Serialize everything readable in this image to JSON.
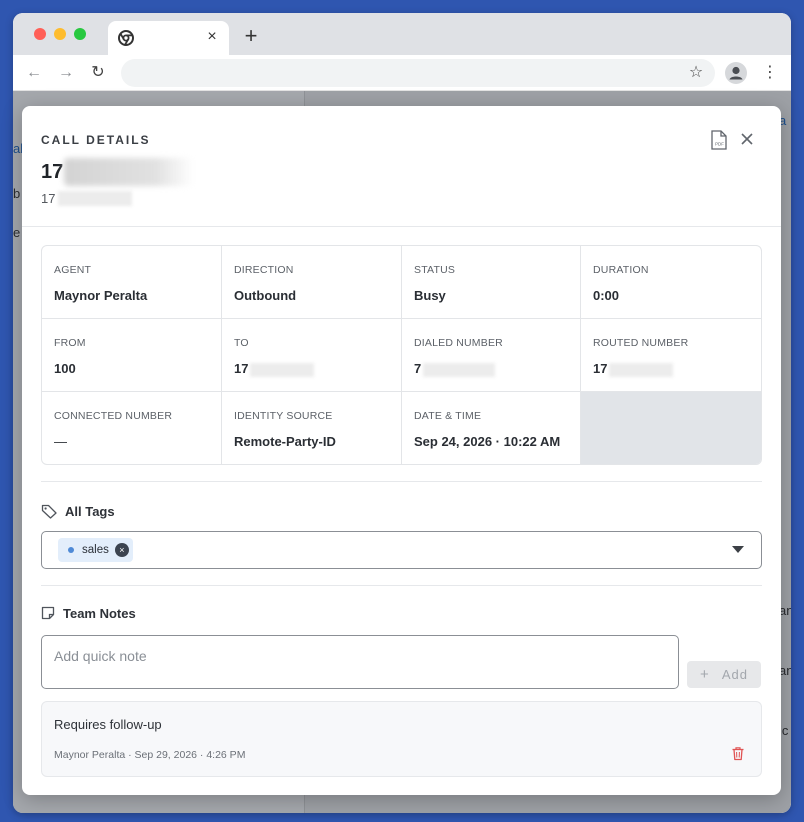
{
  "browser": {
    "tab_close": "×",
    "new_tab": "+",
    "back": "←",
    "forward": "→",
    "reload": "↻",
    "star": "☆",
    "menu": "⋮"
  },
  "background": {
    "fragments": [
      "al",
      "b",
      "e",
      "an",
      "an",
      "ic",
      "a"
    ]
  },
  "modal": {
    "title": "CALL DETAILS",
    "caller_name": "17",
    "caller_number": "17",
    "pdf_icon": "pdf-icon",
    "close_icon": "close-icon"
  },
  "details": [
    {
      "label": "AGENT",
      "value": "Maynor Peralta"
    },
    {
      "label": "DIRECTION",
      "value": "Outbound"
    },
    {
      "label": "STATUS",
      "value": "Busy"
    },
    {
      "label": "DURATION",
      "value": "0:00"
    },
    {
      "label": "FROM",
      "value": "100"
    },
    {
      "label": "TO",
      "value": "17"
    },
    {
      "label": "DIALED NUMBER",
      "value": "7"
    },
    {
      "label": "ROUTED NUMBER",
      "value": "17"
    },
    {
      "label": "CONNECTED NUMBER",
      "value": "—"
    },
    {
      "label": "IDENTITY SOURCE",
      "value": "Remote-Party-ID"
    },
    {
      "label": "DATE & TIME",
      "value": "Sep 24, 2026 · 10:22 AM"
    }
  ],
  "tags": {
    "title": "All Tags",
    "chips": [
      {
        "label": "sales",
        "color": "#4f8ad6"
      }
    ],
    "remove_symbol": "×"
  },
  "notes": {
    "title": "Team Notes",
    "placeholder": "Add quick note",
    "value": "",
    "add_symbol": "+",
    "add_label": "Add",
    "items": [
      {
        "text": "Requires follow-up",
        "meta": "Maynor Peralta · Sep 29, 2026 · 4:26 PM"
      }
    ]
  },
  "colors": {
    "backdrop": "#2f56b0",
    "chip_bg": "#e3eefb",
    "delete": "#e05252"
  }
}
